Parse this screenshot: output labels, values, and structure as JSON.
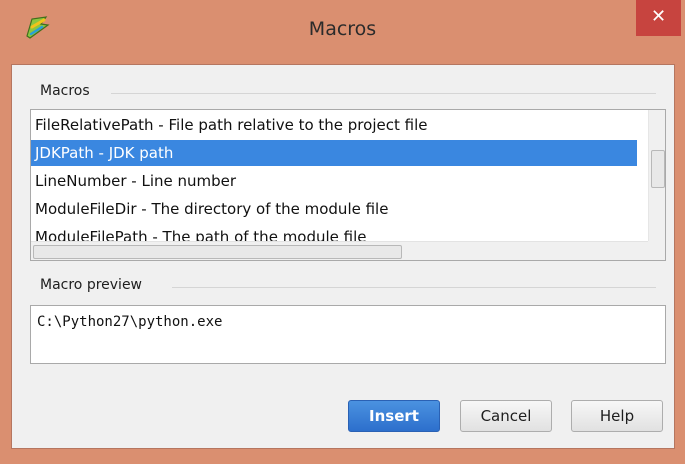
{
  "window": {
    "title": "Macros",
    "close_glyph": "✕",
    "app_icon": "pycharm-logo-icon"
  },
  "macros_group": {
    "label": "Macros",
    "items": [
      "FileRelativePath - File path relative to the project file",
      "JDKPath - JDK path",
      "LineNumber - Line number",
      "ModuleFileDir - The directory of the module file",
      "ModuleFilePath - The path of the module file"
    ],
    "selected_index": 1
  },
  "preview_group": {
    "label": "Macro preview",
    "value": "C:\\Python27\\python.exe"
  },
  "buttons": {
    "insert": "Insert",
    "cancel": "Cancel",
    "help": "Help"
  },
  "colors": {
    "title_bar": "#da8f70",
    "close_button": "#c7443f",
    "selection": "#3a87e0",
    "primary_button": "#2d6fcc"
  }
}
